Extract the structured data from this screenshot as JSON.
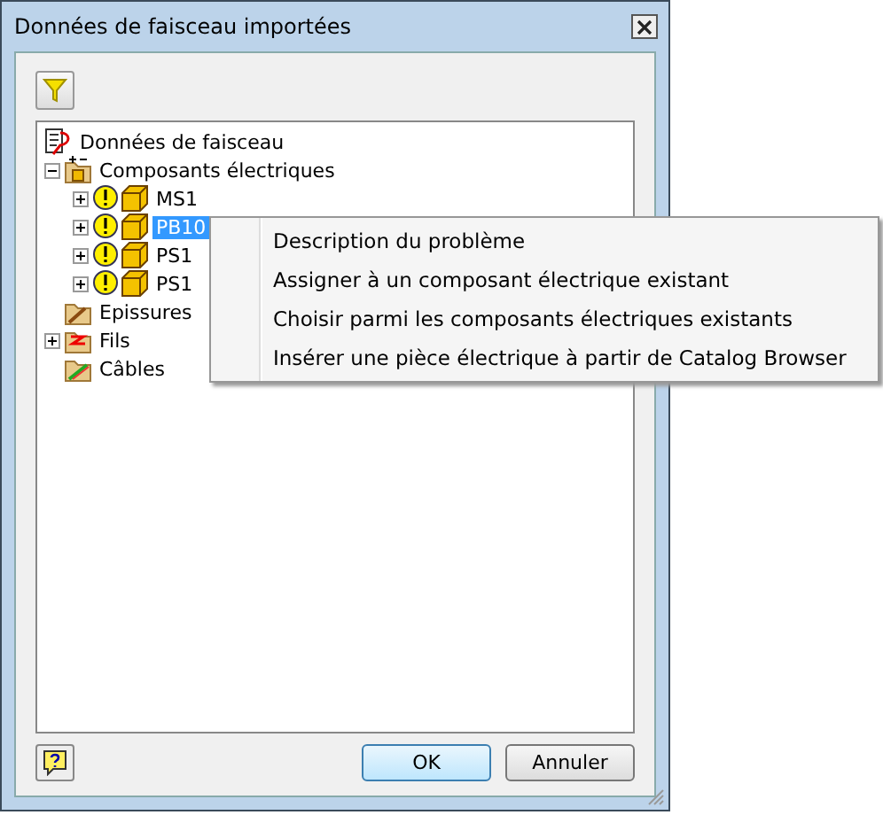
{
  "window": {
    "title": "Données de faisceau importées"
  },
  "tree": [
    {
      "label": "Données de faisceau",
      "kind": "harness",
      "selected": false,
      "children": [
        {
          "label": "Composants électriques",
          "kind": "components",
          "expanded": true,
          "selected": false,
          "children": [
            {
              "label": "MS1",
              "kind": "part",
              "expanded": false,
              "selected": false
            },
            {
              "label": "PB10",
              "kind": "part",
              "expanded": false,
              "selected": true
            },
            {
              "label": "PS1",
              "kind": "part",
              "expanded": false,
              "selected": false
            },
            {
              "label": "PS1",
              "kind": "part",
              "expanded": false,
              "selected": false
            }
          ]
        },
        {
          "label": "Epissures",
          "kind": "splices",
          "selected": false
        },
        {
          "label": "Fils",
          "kind": "wires",
          "expanded": false,
          "selected": false
        },
        {
          "label": "Câbles",
          "kind": "cables",
          "selected": false
        }
      ]
    }
  ],
  "context_menu": [
    "Description du problème",
    "Assigner à un composant électrique existant",
    "Choisir parmi les composants électriques existants",
    "Insérer une pièce électrique à partir de Catalog Browser"
  ],
  "buttons": [
    {
      "label": "OK",
      "default": true
    },
    {
      "label": "Annuler",
      "default": false
    }
  ]
}
